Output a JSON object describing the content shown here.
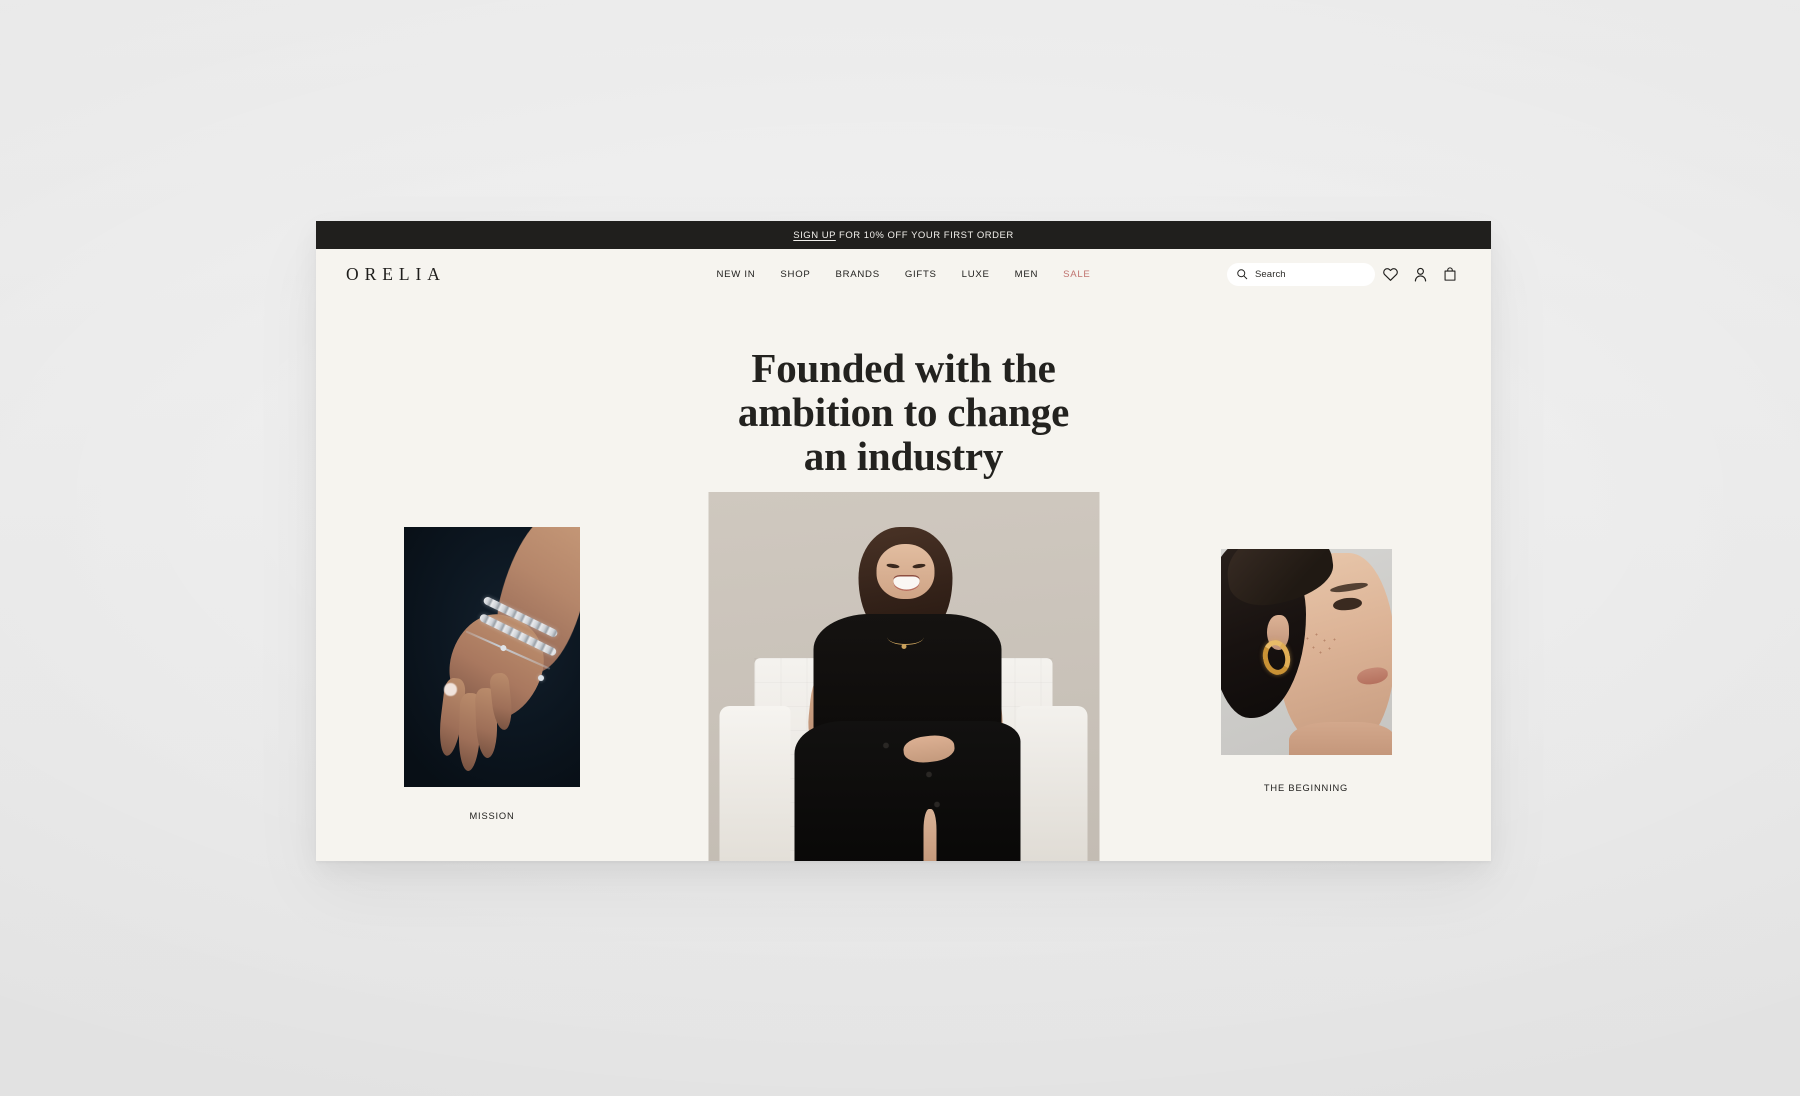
{
  "announcement": {
    "link_label": "SIGN UP",
    "rest_text": " FOR 10% OFF YOUR FIRST ORDER"
  },
  "header": {
    "logo": "ORELIA",
    "nav": [
      {
        "label": "NEW IN",
        "name": "new-in",
        "accent": false
      },
      {
        "label": "SHOP",
        "name": "shop",
        "accent": false
      },
      {
        "label": "BRANDS",
        "name": "brands",
        "accent": false
      },
      {
        "label": "GIFTS",
        "name": "gifts",
        "accent": false
      },
      {
        "label": "LUXE",
        "name": "luxe",
        "accent": false
      },
      {
        "label": "MEN",
        "name": "men",
        "accent": false
      },
      {
        "label": "SALE",
        "name": "sale",
        "accent": true
      }
    ],
    "search": {
      "placeholder": "Search",
      "value": ""
    },
    "icons": {
      "search": "search-icon",
      "wishlist": "heart-icon",
      "account": "person-icon",
      "cart": "shopping-bag-icon"
    }
  },
  "hero": {
    "headline_line1": "Founded with the",
    "headline_line2": "ambition to change",
    "headline_line3": "an industry",
    "left_card": {
      "caption": "MISSION",
      "image_alt": "hand-with-pearl-bracelets"
    },
    "center_card": {
      "image_alt": "founder-portrait-laughing-in-white-armchair"
    },
    "right_card": {
      "caption": "THE BEGINNING",
      "image_alt": "model-wearing-gold-hoop-earring"
    }
  },
  "colors": {
    "page_background": "#f6f4ef",
    "desktop_background": "#e7e7e7",
    "announcement_background": "#201f1d",
    "text": "#1e1d1b",
    "sale_accent": "#c0736f",
    "search_field": "#ffffff"
  }
}
